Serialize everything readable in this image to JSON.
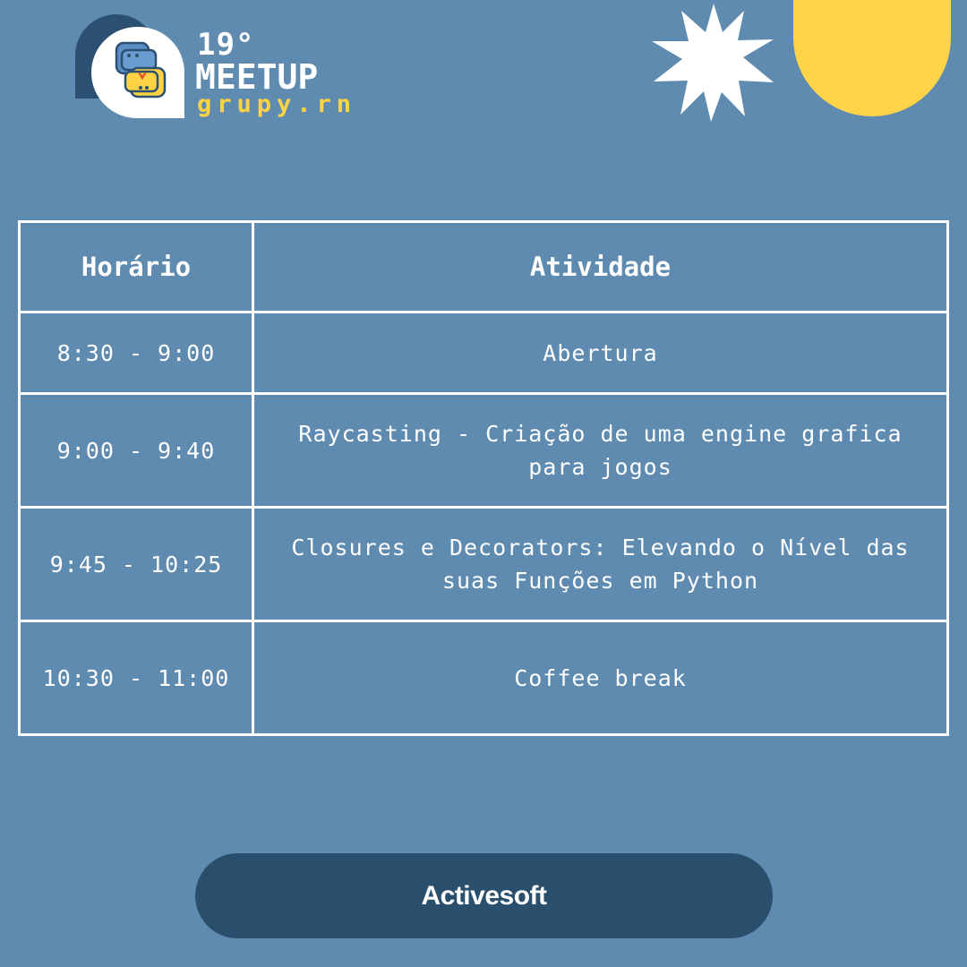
{
  "header": {
    "edition": "19°",
    "title": "MEETUP",
    "org": "grupy.rn"
  },
  "schedule": {
    "headers": {
      "time": "Horário",
      "activity": "Atividade"
    },
    "rows": [
      {
        "time": "8:30 - 9:00",
        "activity": "Abertura"
      },
      {
        "time": "9:00 - 9:40",
        "activity": "Raycasting - Criação de uma engine grafica para jogos"
      },
      {
        "time": "9:45 - 10:25",
        "activity": "Closures e Decorators: Elevando o Nível das suas Funções em Python"
      },
      {
        "time": "10:30 - 11:00",
        "activity": "Coffee break"
      }
    ]
  },
  "sponsor": {
    "name": "Activesoft"
  },
  "colors": {
    "background": "#5f8bb0",
    "dark_blue": "#2a4f6d",
    "yellow": "#ffd448",
    "python_blue": "#6a9dd0",
    "python_yellow": "#ffd343"
  },
  "icons": {
    "logo": "python-logo-icon",
    "star": "starburst-icon"
  }
}
